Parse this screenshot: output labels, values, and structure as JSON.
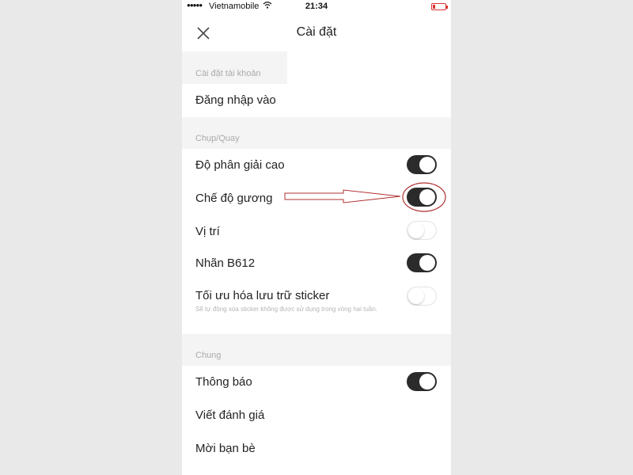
{
  "status_bar": {
    "signal": "●●●●●",
    "carrier": "Vietnamobile",
    "time": "21:34"
  },
  "header": {
    "title": "Cài đặt"
  },
  "sections": {
    "account": {
      "header": "Cài đặt tài khoản",
      "login_label": "Đăng nhập vào"
    },
    "capture": {
      "header": "Chụp/Quay",
      "high_resolution": {
        "label": "Độ phân giải cao",
        "on": true
      },
      "mirror_mode": {
        "label": "Chế độ gương",
        "on": true
      },
      "location": {
        "label": "Vị trí",
        "on": false
      },
      "b612_label": {
        "label": "Nhãn B612",
        "on": true
      },
      "sticker_optimize": {
        "label": "Tối ưu hóa lưu trữ sticker",
        "description": "Sẽ tự động xóa sticker không được sử dụng trong vòng hai tuần.",
        "on": false
      }
    },
    "general": {
      "header": "Chung",
      "notifications": {
        "label": "Thông báo",
        "on": true
      },
      "write_review": {
        "label": "Viết đánh giá"
      },
      "invite_friends": {
        "label": "Mời bạn bè"
      }
    }
  },
  "colors": {
    "toggle_on": "#2b2b2b",
    "section_background": "#f4f4f4",
    "annotation": "#b03030"
  }
}
